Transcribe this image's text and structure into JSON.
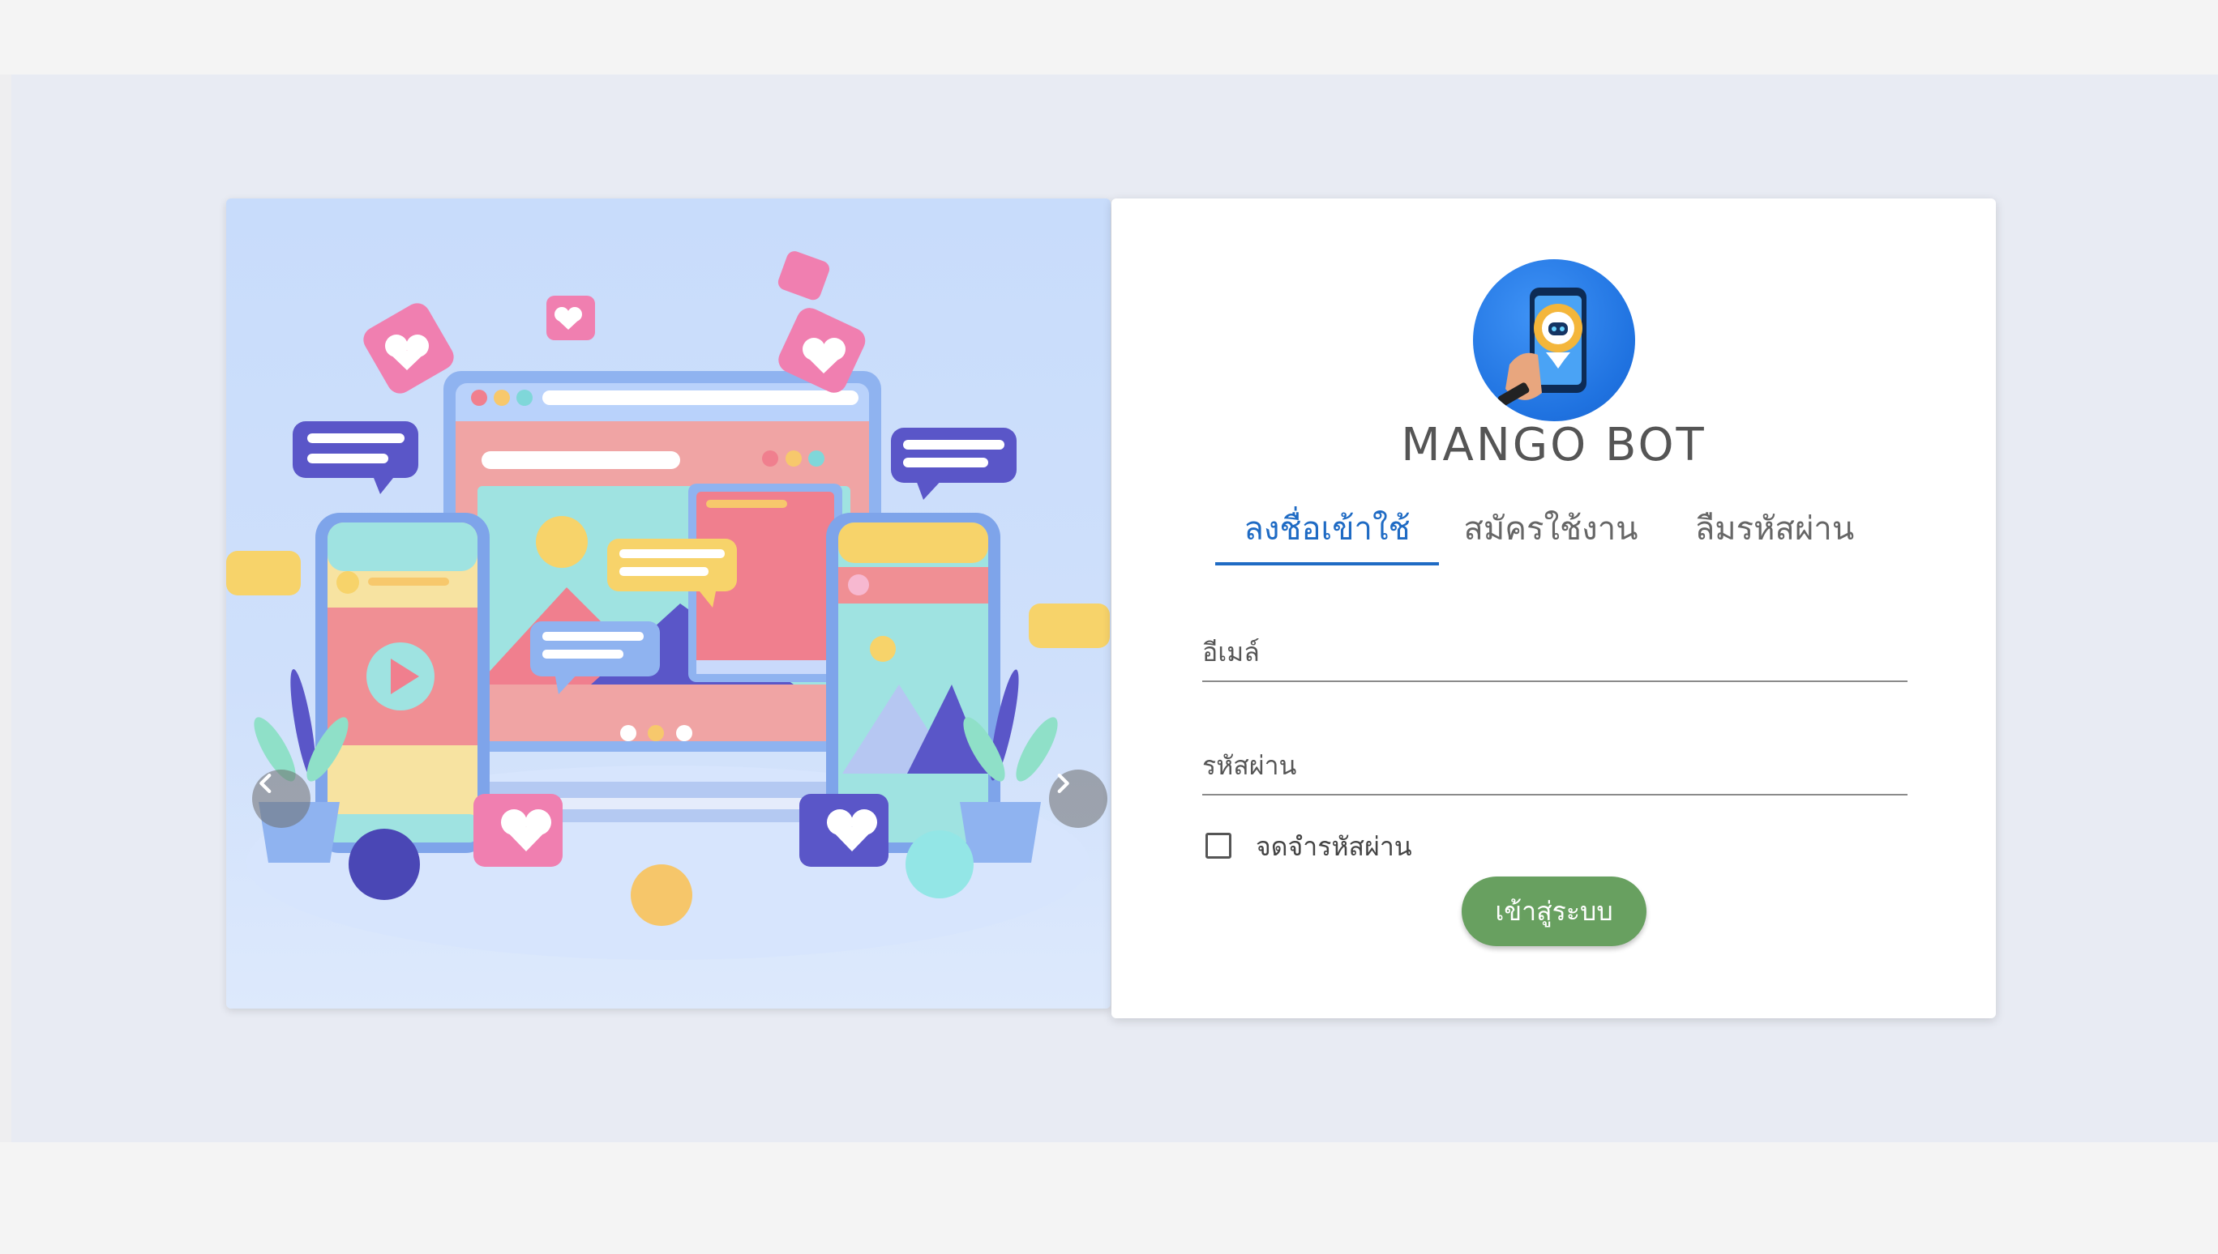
{
  "brand": {
    "name": "MANGO BOT",
    "logo_icon": "robot-chat-phone-icon"
  },
  "tabs": [
    {
      "label": "ลงชื่อเข้าใช้",
      "active": true
    },
    {
      "label": "สมัครใช้งาน",
      "active": false
    },
    {
      "label": "ลืมรหัสผ่าน",
      "active": false
    }
  ],
  "form": {
    "email_label": "อีเมล์",
    "email_value": "",
    "password_label": "รหัสผ่าน",
    "password_value": "",
    "remember_label": "จดจำรหัสผ่าน",
    "remember_checked": false,
    "submit_label": "เข้าสู่ระบบ"
  },
  "carousel": {
    "prev_icon": "chevron-left-icon",
    "next_icon": "chevron-right-icon"
  },
  "colors": {
    "accent": "#1f6bc4",
    "button": "#68a060",
    "background": "#e8ebf3"
  }
}
